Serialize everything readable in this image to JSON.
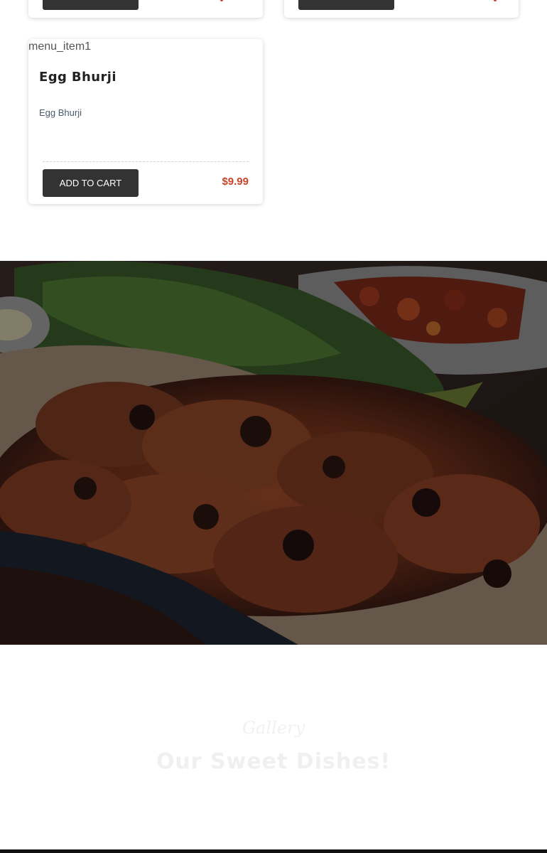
{
  "menu": {
    "item": {
      "image_alt": "menu_item1",
      "title": "Egg Bhurji",
      "description": "Egg Bhurji",
      "add_to_cart_label": "ADD TO CART",
      "price": "$9.99"
    }
  },
  "gallery": {
    "subtitle": "Gallery",
    "title": "Our Sweet Dishes!"
  },
  "colors": {
    "accent_price": "#c9442a",
    "button_dark": "#333333"
  }
}
